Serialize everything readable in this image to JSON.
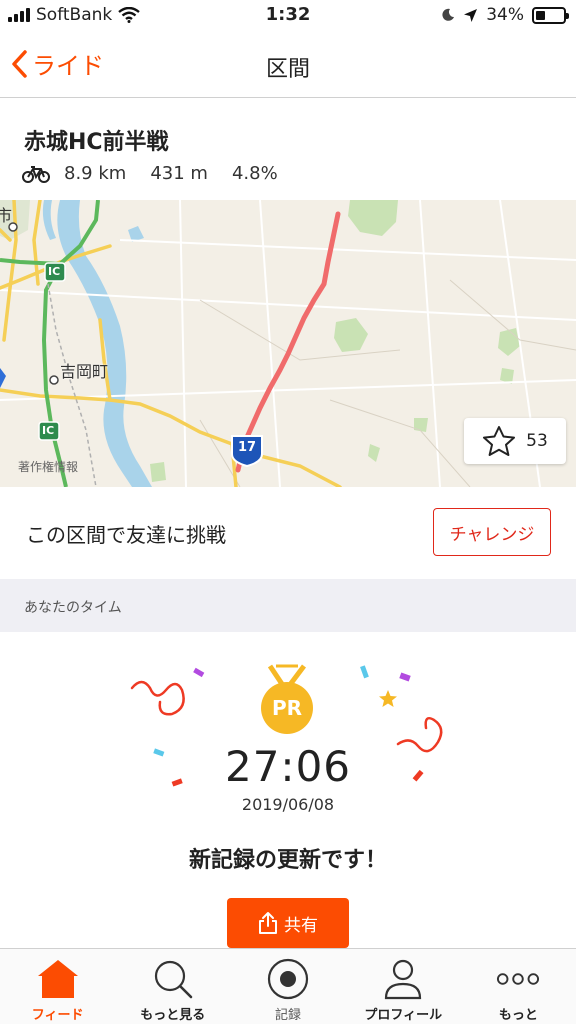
{
  "status_bar": {
    "carrier": "SoftBank",
    "time": "1:32",
    "battery_text": "34%",
    "battery_level": 0.34
  },
  "nav": {
    "back_label": "ライド",
    "title": "区間"
  },
  "segment": {
    "title": "赤城HC前半戦",
    "distance": "8.9 km",
    "elevation": "431 m",
    "grade": "4.8%"
  },
  "map": {
    "labels": {
      "town": "吉岡町",
      "route_number": "17",
      "ic_1": "IC",
      "ic_2": "IC",
      "attribution": "著作権情報",
      "edge_char": "市"
    },
    "star_count": "53"
  },
  "challenge": {
    "text": "この区間で友達に挑戦",
    "button_label": "チャレンジ"
  },
  "section_header": "あなたのタイム",
  "pr": {
    "badge": "PR",
    "time": "27:06",
    "date": "2019/06/08",
    "message": "新記録の更新です！",
    "share_label": "共有"
  },
  "tabs": [
    {
      "label": "フィード",
      "icon": "home-icon",
      "active": true
    },
    {
      "label": "もっと見る",
      "icon": "search-icon",
      "active": false
    },
    {
      "label": "記録",
      "icon": "record-icon",
      "active": false
    },
    {
      "label": "プロフィール",
      "icon": "profile-icon",
      "active": false
    },
    {
      "label": "もっと",
      "icon": "more-icon",
      "active": false
    }
  ],
  "colors": {
    "accent": "#fc4c02",
    "challenge": "#e0281a",
    "route": "#f06b6b",
    "gold": "#f6b825"
  }
}
